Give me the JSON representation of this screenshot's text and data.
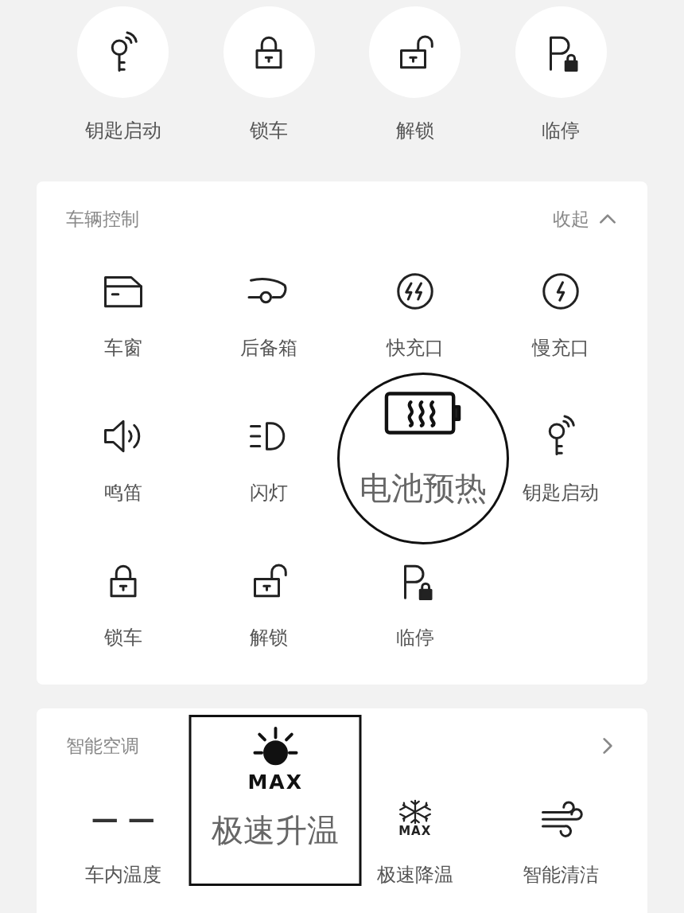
{
  "quick_actions": [
    {
      "label": "钥匙启动",
      "kind": "key"
    },
    {
      "label": "锁车",
      "kind": "lock"
    },
    {
      "label": "解锁",
      "kind": "unlock"
    },
    {
      "label": "临停",
      "kind": "park"
    }
  ],
  "vehicle_control": {
    "title": "车辆控制",
    "collapse": "收起",
    "items": [
      {
        "label": "车窗",
        "kind": "window",
        "magnified": false
      },
      {
        "label": "后备箱",
        "kind": "trunk",
        "magnified": false
      },
      {
        "label": "快充口",
        "kind": "fast-charge",
        "magnified": false
      },
      {
        "label": "慢充口",
        "kind": "slow-charge",
        "magnified": false
      },
      {
        "label": "鸣笛",
        "kind": "horn",
        "magnified": false
      },
      {
        "label": "闪灯",
        "kind": "light",
        "magnified": false
      },
      {
        "label": "电池预热",
        "kind": "battery-heat",
        "magnified": true
      },
      {
        "label": "钥匙启动",
        "kind": "key",
        "magnified": false
      },
      {
        "label": "锁车",
        "kind": "lock",
        "magnified": false
      },
      {
        "label": "解锁",
        "kind": "unlock",
        "magnified": false
      },
      {
        "label": "临停",
        "kind": "park",
        "magnified": false
      }
    ]
  },
  "climate": {
    "title": "智能空调",
    "items": [
      {
        "label": "车内温度",
        "kind": "reading",
        "value": "— —",
        "magnified": false
      },
      {
        "label": "极速升温",
        "kind": "sun",
        "badge": "MAX",
        "magnified": true
      },
      {
        "label": "极速降温",
        "kind": "snow",
        "badge": "MAX",
        "magnified": false
      },
      {
        "label": "智能清洁",
        "kind": "wind",
        "magnified": false
      }
    ]
  }
}
